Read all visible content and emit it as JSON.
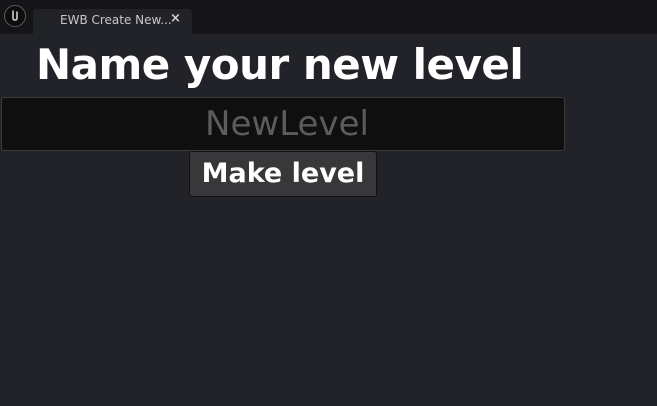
{
  "window": {
    "tab_title": "EWB Create New...",
    "close_glyph": "×",
    "logo_icon": "unreal-engine-logo-icon"
  },
  "main": {
    "heading": "Name your new level",
    "level_name_input": {
      "value": "",
      "placeholder": "NewLevel"
    },
    "make_level_label": "Make level"
  },
  "colors": {
    "background": "#222328",
    "titlebar": "#151518",
    "input_bg": "#0f0f10",
    "button_bg": "#38383b",
    "text": "#ffffff"
  }
}
